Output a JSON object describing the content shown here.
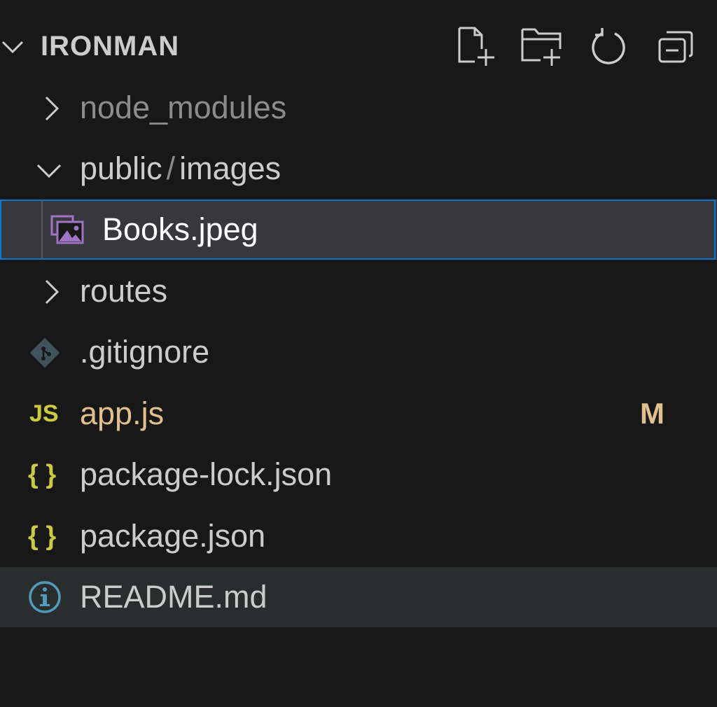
{
  "explorer": {
    "title": "IRONMAN",
    "actions": [
      {
        "name": "new-file",
        "icon": "new-file-icon"
      },
      {
        "name": "new-folder",
        "icon": "new-folder-icon"
      },
      {
        "name": "refresh",
        "icon": "refresh-icon"
      },
      {
        "name": "collapse-all",
        "icon": "collapse-all-icon"
      }
    ]
  },
  "tree": {
    "node_modules": {
      "label": "node_modules",
      "icon": "chevron-right-icon",
      "state": "collapsed"
    },
    "public_images": {
      "part1": "public",
      "sep": "/",
      "part2": "images",
      "icon": "chevron-down-icon",
      "state": "expanded"
    },
    "books": {
      "label": "Books.jpeg",
      "icon": "image-file-icon",
      "selected": true
    },
    "routes": {
      "label": "routes",
      "icon": "chevron-right-icon",
      "state": "collapsed"
    },
    "gitignore": {
      "label": ".gitignore",
      "icon": "git-icon"
    },
    "appjs": {
      "label": "app.js",
      "icon_text": "JS",
      "badge": "M"
    },
    "package_lock": {
      "label": "package-lock.json",
      "icon_text": "{ }"
    },
    "package_json": {
      "label": "package.json",
      "icon_text": "{ }"
    },
    "readme": {
      "label": "README.md",
      "icon": "info-icon"
    }
  },
  "colors": {
    "background": "#181818",
    "text": "#cccccc",
    "dimmed_text": "#8c8c8c",
    "selection_bg": "#37373d",
    "focus_border": "#0078d4",
    "modified": "#e2c08d",
    "js_icon": "#cbcb41",
    "json_icon": "#cbcb41",
    "image_icon": "#a074c4",
    "git_icon": "#41535b",
    "info_icon": "#519aba"
  }
}
